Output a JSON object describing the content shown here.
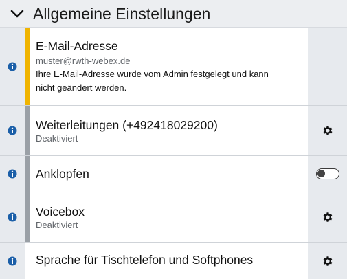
{
  "section": {
    "title": "Allgemeine Einstellungen",
    "expanded": true
  },
  "rows": [
    {
      "title": "E-Mail-Adresse",
      "subtitle": "muster@rwth-webex.de",
      "note": "Ihre E-Mail-Adresse wurde vom Admin festgelegt und kann nicht geändert werden.",
      "stripe_color": "#f0b400",
      "action": "none"
    },
    {
      "title": "Weiterleitungen (+492418029200)",
      "subtitle": "Deaktiviert",
      "stripe_color": "#9aa0a6",
      "action": "gear-icon"
    },
    {
      "title": "Anklopfen",
      "stripe_color": "#9aa0a6",
      "action": "toggle",
      "toggle_on": false
    },
    {
      "title": "Voicebox",
      "subtitle": "Deaktiviert",
      "stripe_color": "#9aa0a6",
      "action": "gear-icon"
    },
    {
      "title": "Sprache für Tischtelefon und Softphones",
      "action": "gear-icon"
    }
  ],
  "colors": {
    "info_icon": "#1b5fa8",
    "accent_yellow": "#f0b400",
    "stripe_gray": "#9aa0a6"
  },
  "icons": [
    "chevron-down-icon",
    "info-icon",
    "gear-icon"
  ]
}
